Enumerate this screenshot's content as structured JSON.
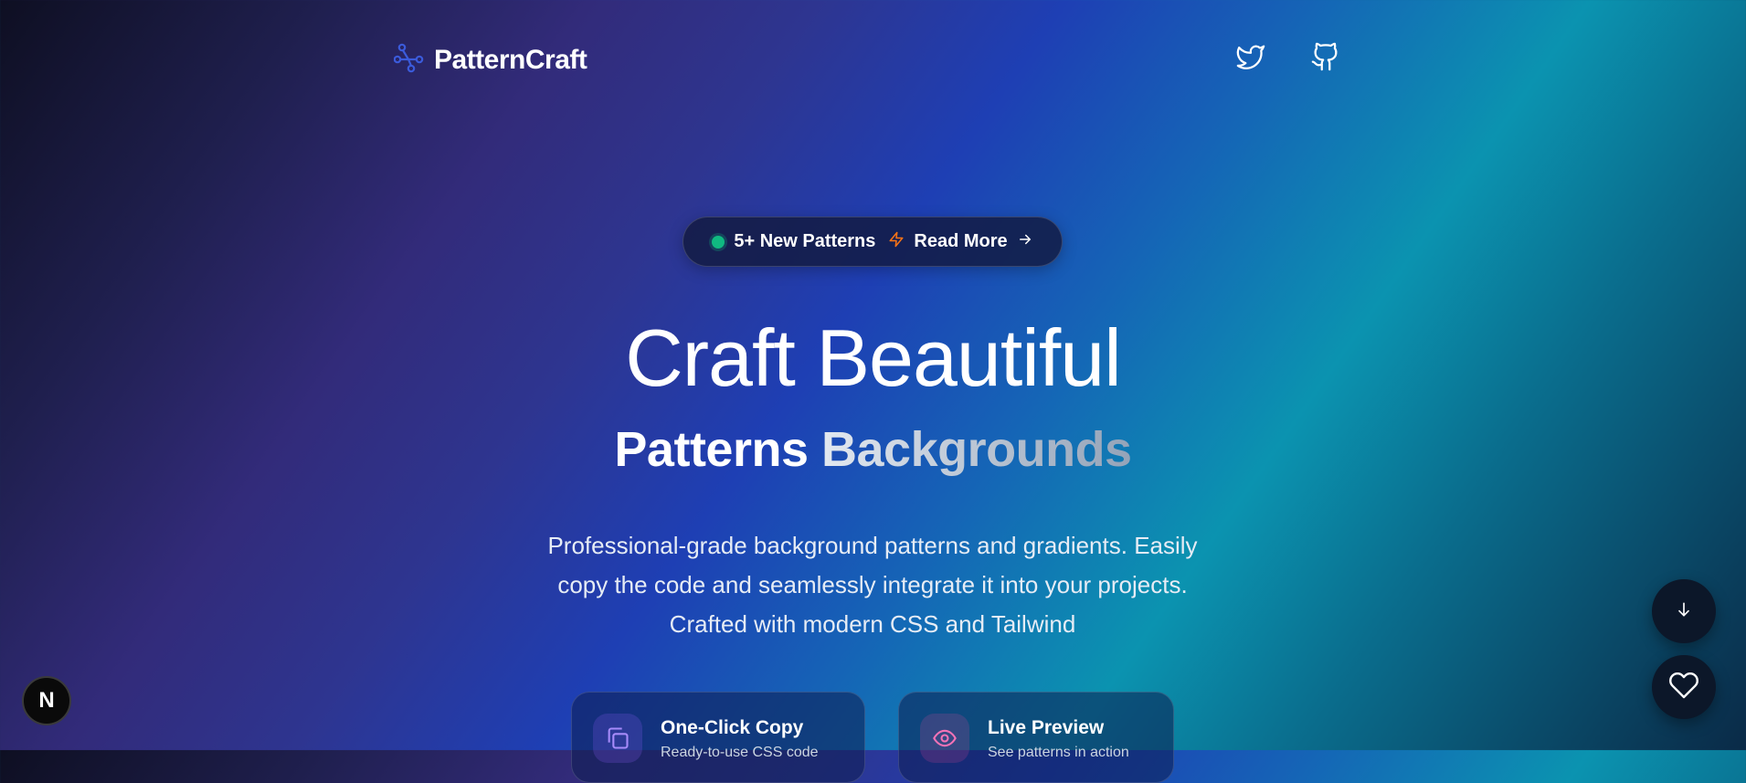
{
  "header": {
    "logo_text": "PatternCraft",
    "icons": [
      "twitter-icon",
      "github-icon"
    ]
  },
  "badge": {
    "new_text": "5+ New Patterns",
    "link_text": "Read More",
    "status_color": "#10b981",
    "bolt_color": "#f97316"
  },
  "hero": {
    "title": "Craft Beautiful",
    "subtitle_part1": "Patterns",
    "subtitle_part2": "Backgrounds",
    "description_line1": "Professional-grade background patterns and gradients. Easily",
    "description_line2": "copy the code and seamlessly integrate it into your projects.",
    "description_line3": "Crafted with modern CSS and Tailwind"
  },
  "features": [
    {
      "title": "One-Click Copy",
      "subtitle": "Ready-to-use CSS code",
      "icon": "copy-icon",
      "color": "#a78bfa"
    },
    {
      "title": "Live Preview",
      "subtitle": "See patterns in action",
      "icon": "eye-icon",
      "color": "#f472b6"
    }
  ],
  "floating": {
    "scroll_icon": "arrow-down-icon",
    "favorite_icon": "heart-icon",
    "framework_badge": "N"
  }
}
